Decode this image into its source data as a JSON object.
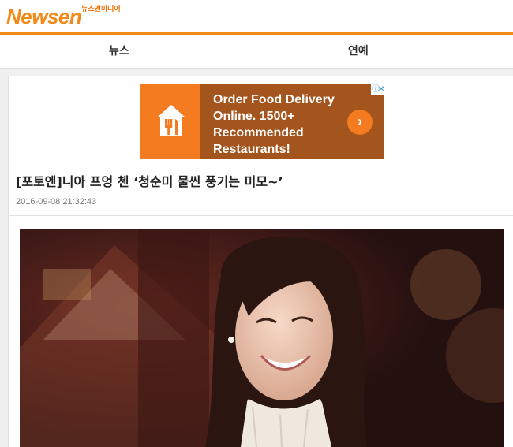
{
  "header": {
    "logo_text": "Newsen",
    "logo_sub": "뉴스엔미디어",
    "brand_color": "#f28a1a"
  },
  "nav": {
    "items": [
      {
        "label": "뉴스"
      },
      {
        "label": "연예"
      }
    ]
  },
  "ad": {
    "text": "Order Food Delivery Online. 1500+ Recommended Restaurants!",
    "cta_icon": "chevron-right-icon",
    "info_icon": "info-icon",
    "close_icon": "close-icon",
    "background_color": "#a4551d",
    "accent_color": "#f47b20"
  },
  "article": {
    "title": "[포토엔]니아 프엉 첸 ‘청순미 물씬 풍기는 미모~’",
    "date": "2016-09-08 21:32:43"
  }
}
